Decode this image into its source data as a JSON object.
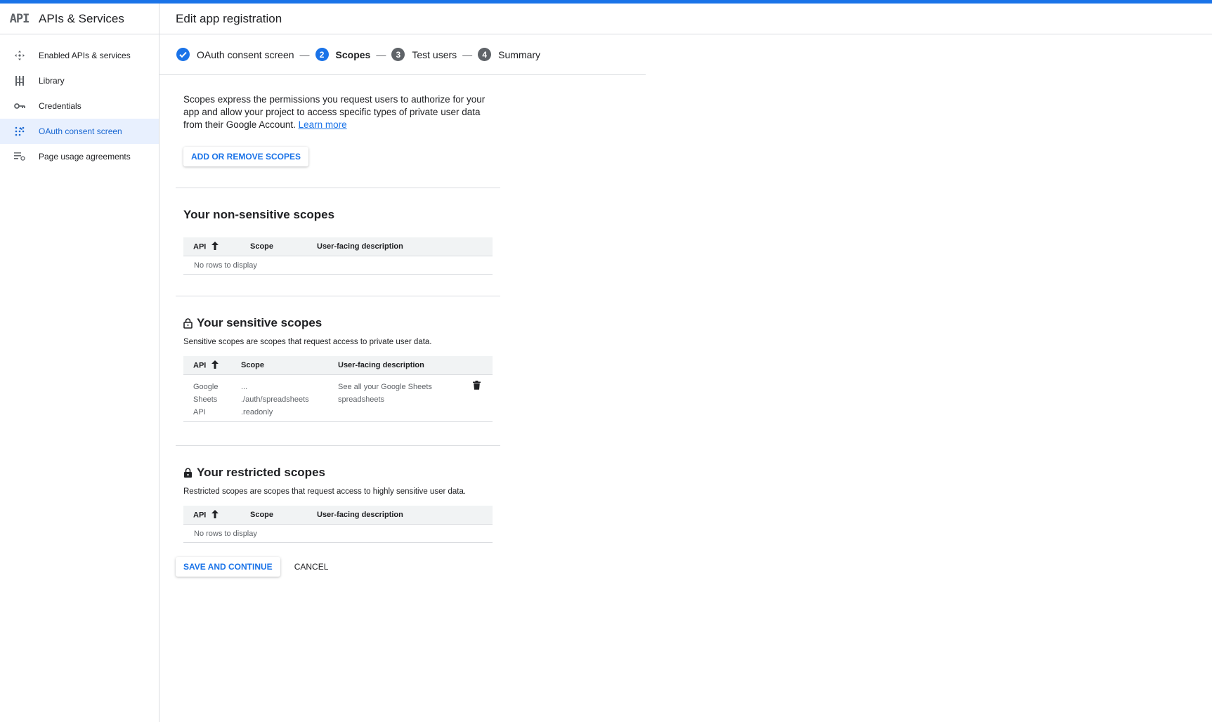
{
  "sidebar": {
    "logo": "API",
    "title": "APIs & Services",
    "items": [
      {
        "label": "Enabled APIs & services"
      },
      {
        "label": "Library"
      },
      {
        "label": "Credentials"
      },
      {
        "label": "OAuth consent screen"
      },
      {
        "label": "Page usage agreements"
      }
    ]
  },
  "header": {
    "title": "Edit app registration"
  },
  "stepper": {
    "steps": [
      {
        "number": "",
        "label": "OAuth consent screen",
        "state": "done"
      },
      {
        "number": "2",
        "label": "Scopes",
        "state": "current"
      },
      {
        "number": "3",
        "label": "Test users",
        "state": "pending"
      },
      {
        "number": "4",
        "label": "Summary",
        "state": "pending"
      }
    ],
    "separator": "—"
  },
  "intro": {
    "text": "Scopes express the permissions you request users to authorize for your app and allow your project to access specific types of private user data from their Google Account.",
    "link": "Learn more"
  },
  "add_remove_button": "ADD OR REMOVE SCOPES",
  "table_headers": {
    "api": "API",
    "scope": "Scope",
    "description": "User-facing description"
  },
  "non_sensitive": {
    "title": "Your non-sensitive scopes",
    "empty": "No rows to display"
  },
  "sensitive": {
    "title": "Your sensitive scopes",
    "desc": "Sensitive scopes are scopes that request access to private user data.",
    "rows": [
      {
        "api": [
          "Google",
          "Sheets",
          "API"
        ],
        "scope": [
          "...",
          "./auth/spreadsheets",
          ".readonly"
        ],
        "description": [
          "See all your Google Sheets",
          "spreadsheets"
        ]
      }
    ]
  },
  "restricted": {
    "title": "Your restricted scopes",
    "desc": "Restricted scopes are scopes that request access to highly sensitive user data.",
    "empty": "No rows to display"
  },
  "actions": {
    "save": "SAVE AND CONTINUE",
    "cancel": "CANCEL"
  }
}
